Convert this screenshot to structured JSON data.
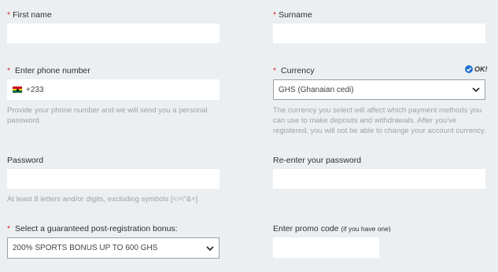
{
  "first_name": {
    "label": "First name",
    "required": "*",
    "value": ""
  },
  "surname": {
    "label": "Surname",
    "required": "*",
    "value": ""
  },
  "phone": {
    "label": "Enter phone number",
    "required": "*",
    "prefix": "+233",
    "flag": "ghana-flag-icon",
    "hint": "Provide your phone number and we will send you a personal password."
  },
  "currency": {
    "label": "Currency",
    "required": "*",
    "selected": "GHS (Ghanaian cedi)",
    "status": "OK!",
    "hint": "The currency you select will affect which payment methods you can use to make deposits and withdrawals. After you've registered, you will not be able to change your account currency."
  },
  "password": {
    "label": "Password",
    "value": "",
    "hint": "At least 8 letters and/or digits, excluding symbols [<>\\\"&+]"
  },
  "reenter_password": {
    "label": "Re-enter your password",
    "value": ""
  },
  "bonus": {
    "label": "Select a guaranteed post-registration bonus:",
    "required": "*",
    "selected": "200% SPORTS BONUS UP TO 600 GHS"
  },
  "promo": {
    "label": "Enter promo code",
    "label_note": "(if you have one)",
    "value": ""
  },
  "colors": {
    "required": "#d8262b",
    "ok_check": "#1f6fd1",
    "background": "#eceff1"
  }
}
